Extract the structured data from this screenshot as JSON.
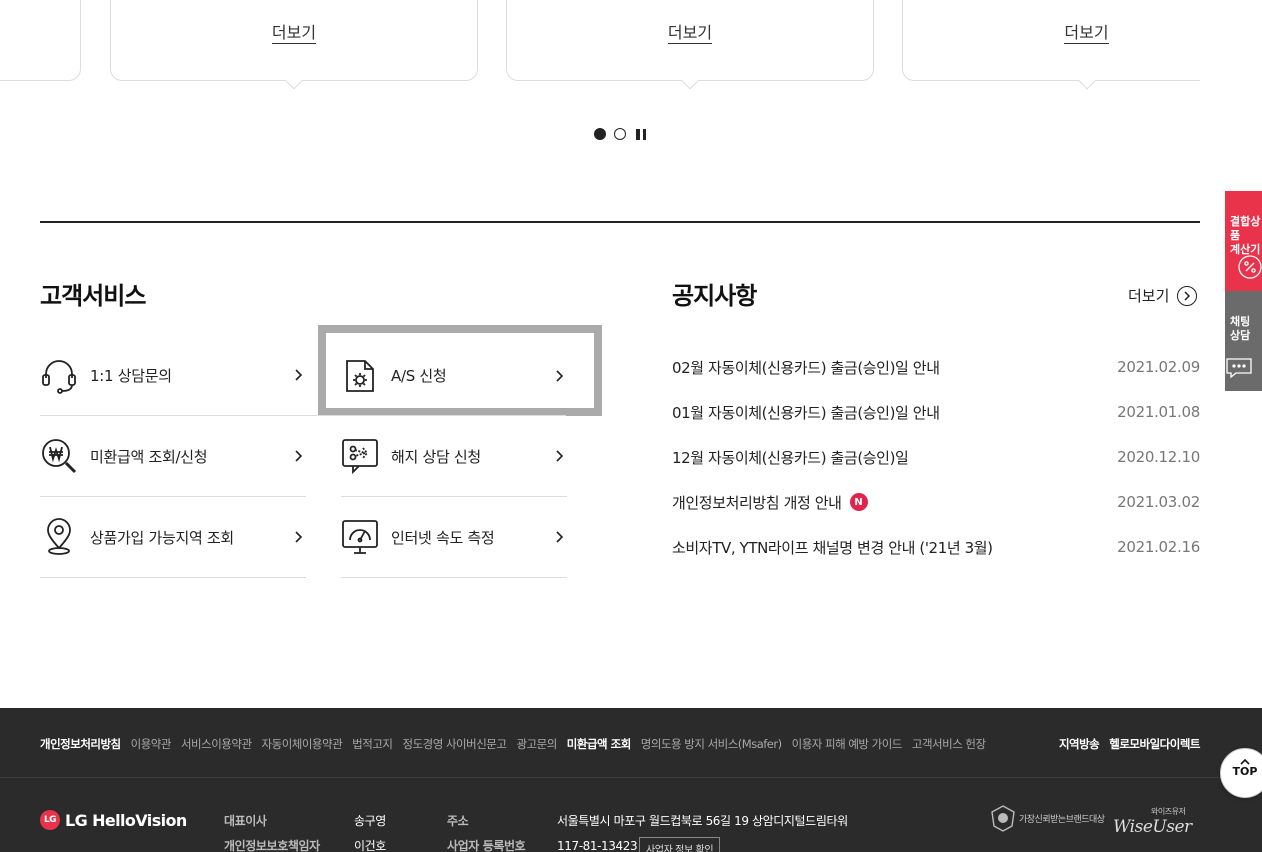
{
  "carousel": {
    "more_labels": [
      "더보기",
      "더보기",
      "더보기"
    ]
  },
  "customer_service": {
    "title": "고객서비스",
    "items": [
      {
        "label": "1:1 상담문의",
        "icon": "headset-icon"
      },
      {
        "label": "A/S 신청",
        "icon": "document-gear-icon"
      },
      {
        "label": "미환급액 조회/신청",
        "icon": "won-search-icon"
      },
      {
        "label": "해지 상담 신청",
        "icon": "scissors-cut-icon"
      },
      {
        "label": "상품가입 가능지역 조회",
        "icon": "location-pin-icon"
      },
      {
        "label": "인터넷 속도 측정",
        "icon": "speedometer-monitor-icon"
      }
    ]
  },
  "notices": {
    "title": "공지사항",
    "more_label": "더보기",
    "items": [
      {
        "title": "02월 자동이체(신용카드) 출금(승인)일 안내",
        "date": "2021.02.09",
        "new": false
      },
      {
        "title": "01월 자동이체(신용카드) 출금(승인)일 안내",
        "date": "2021.01.08",
        "new": false
      },
      {
        "title": "12월 자동이체(신용카드) 출금(승인)일",
        "date": "2020.12.10",
        "new": false
      },
      {
        "title": "개인정보처리방침 개정 안내",
        "date": "2021.03.02",
        "new": true,
        "badge": "N"
      },
      {
        "title": "소비자TV, YTN라이프 채널명 변경 안내 ('21년 3월)",
        "date": "2021.02.16",
        "new": false
      }
    ]
  },
  "floating": {
    "calc_label": [
      "결합상품",
      "계산기"
    ],
    "chat_label": [
      "채팅",
      "상담"
    ],
    "top_label": "TOP"
  },
  "footer": {
    "links": [
      "개인정보처리방침",
      "이용약관",
      "서비스이용약관",
      "자동이체이용약관",
      "법적고지",
      "정도경영 사이버신문고",
      "광고문의",
      "미환급액 조회",
      "명의도용 방지 서비스(Msafer)",
      "이용자 피해 예방 가이드",
      "고객서비스 헌장"
    ],
    "right_links": [
      "지역방송",
      "헬로모바일다이렉트"
    ],
    "logo": "LG HelloVision",
    "logo_mark": "LG",
    "info": {
      "ceo_label": "대표이사",
      "ceo": "송구영",
      "privacy_label": "개인정보보호책임자",
      "privacy": "이건호",
      "address_label": "주소",
      "address": "서울특별시 마포구 월드컵북로 56길 19 상암디지털드림타워",
      "biz_label": "사업자 등록번호",
      "biz_no": "117-81-13423",
      "biz_button": "사업자 정보 확인"
    },
    "awards": [
      "가장신뢰받는브랜드대상",
      "와이즈유저",
      "WiseUser"
    ]
  },
  "colors": {
    "accent_red": "#e8334a",
    "badge_red": "#e0254d",
    "footer_bg": "#2b2b2b",
    "focus_gray": "#aaaaaa"
  }
}
